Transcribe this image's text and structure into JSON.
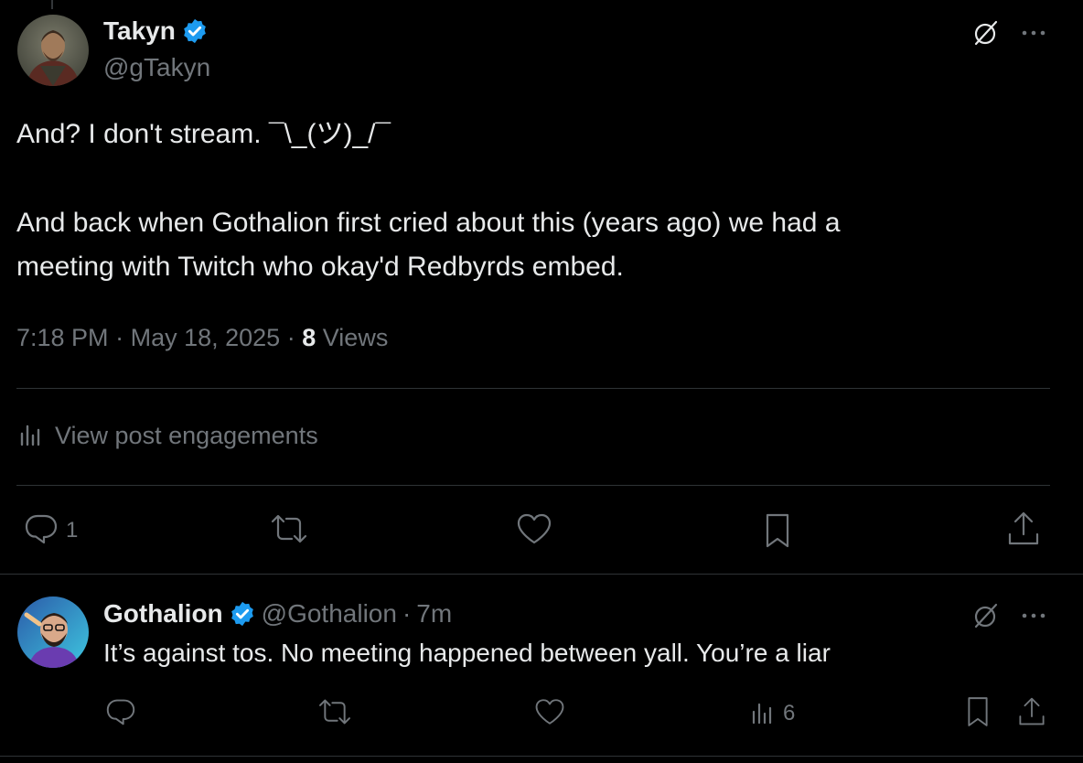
{
  "main_post": {
    "author": {
      "name": "Takyn",
      "handle": "@gTakyn",
      "verified": true
    },
    "text_line1": "And? I don't stream. ¯\\_(ツ)_/¯",
    "text_para2": "And back when Gothalion first cried about this (years ago) we had a\nmeeting with Twitch who okay'd Redbyrds embed.",
    "time": "7:18 PM",
    "date": "May 18, 2025",
    "views_count": "8",
    "views_label": "Views",
    "separator": "·",
    "engagements_label": "View post engagements",
    "actions": {
      "reply_count": "1"
    }
  },
  "reply": {
    "author": {
      "name": "Gothalion",
      "handle": "@Gothalion",
      "verified": true
    },
    "separator": "·",
    "time_ago": "7m",
    "text": "It’s against tos. No meeting happened between yall. You’re a liar",
    "actions": {
      "views_count": "6"
    }
  },
  "colors": {
    "background": "#000000",
    "text": "#e7e9ea",
    "muted": "#71767b",
    "verified": "#1d9bf0",
    "divider": "#2f3336"
  },
  "icons": [
    "grok-icon",
    "more-icon",
    "reply-icon",
    "repost-icon",
    "like-icon",
    "bookmark-icon",
    "share-icon",
    "analytics-icon",
    "verified-badge-icon"
  ]
}
